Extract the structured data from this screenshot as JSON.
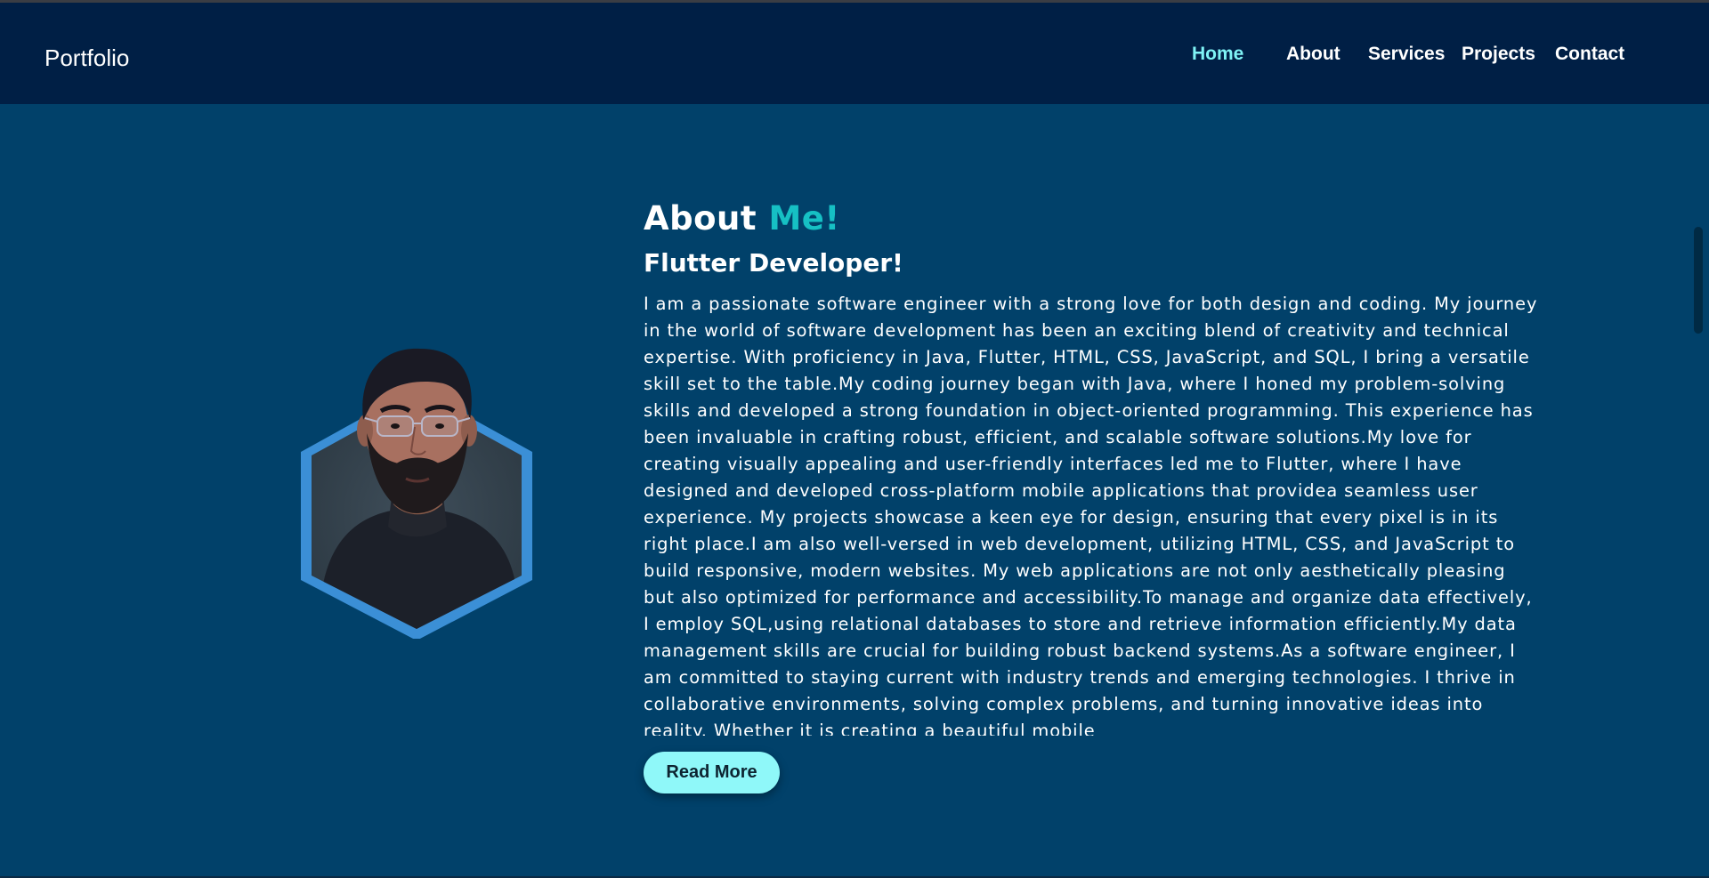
{
  "brand": {
    "text": "Portfolio"
  },
  "nav": {
    "items": [
      {
        "label": "Home",
        "active": true
      },
      {
        "label": "About",
        "active": false
      },
      {
        "label": "Services",
        "active": false
      },
      {
        "label": "Projects",
        "active": false
      },
      {
        "label": "Contact",
        "active": false
      }
    ]
  },
  "about": {
    "heading_main": "About ",
    "heading_accent": "Me!",
    "subheading": "Flutter Developer!",
    "bio": "I am a passionate software engineer with a strong love for both design and coding. My journey in the world of software development has been an exciting blend of creativity and technical expertise. With proficiency in Java, Flutter, HTML, CSS, JavaScript, and SQL, I bring a versatile skill set to the table.My coding journey began with Java, where I honed my problem-solving skills and developed a strong foundation in object-oriented programming. This experience has been invaluable in crafting robust, efficient, and scalable software solutions.My love for creating visually appealing and user-friendly interfaces led me to Flutter, where I have designed and developed cross-platform mobile applications that providea seamless user experience. My projects showcase a keen eye for design, ensuring that every pixel is in its right place.I am also well-versed in web development, utilizing HTML, CSS, and JavaScript to build responsive, modern websites. My web applications are not only aesthetically pleasing but also optimized for performance and accessibility.To manage and organize data effectively, I employ SQL,using relational databases to store and retrieve information efficiently.My data management skills are crucial for building robust backend systems.As a software engineer, I am committed to staying current with industry trends and emerging technologies. I thrive in collaborative environments, solving complex problems, and turning innovative ideas into reality. Whether it is creating a beautiful mobile",
    "read_more_label": "Read More"
  },
  "colors": {
    "navbar_bg": "#001f45",
    "page_bg": "#01416a",
    "accent_teal": "#16c0c4",
    "active_nav": "#7ff3f5",
    "button_bg": "#8ff8f9",
    "hexagon_border": "#3b8fd6"
  }
}
